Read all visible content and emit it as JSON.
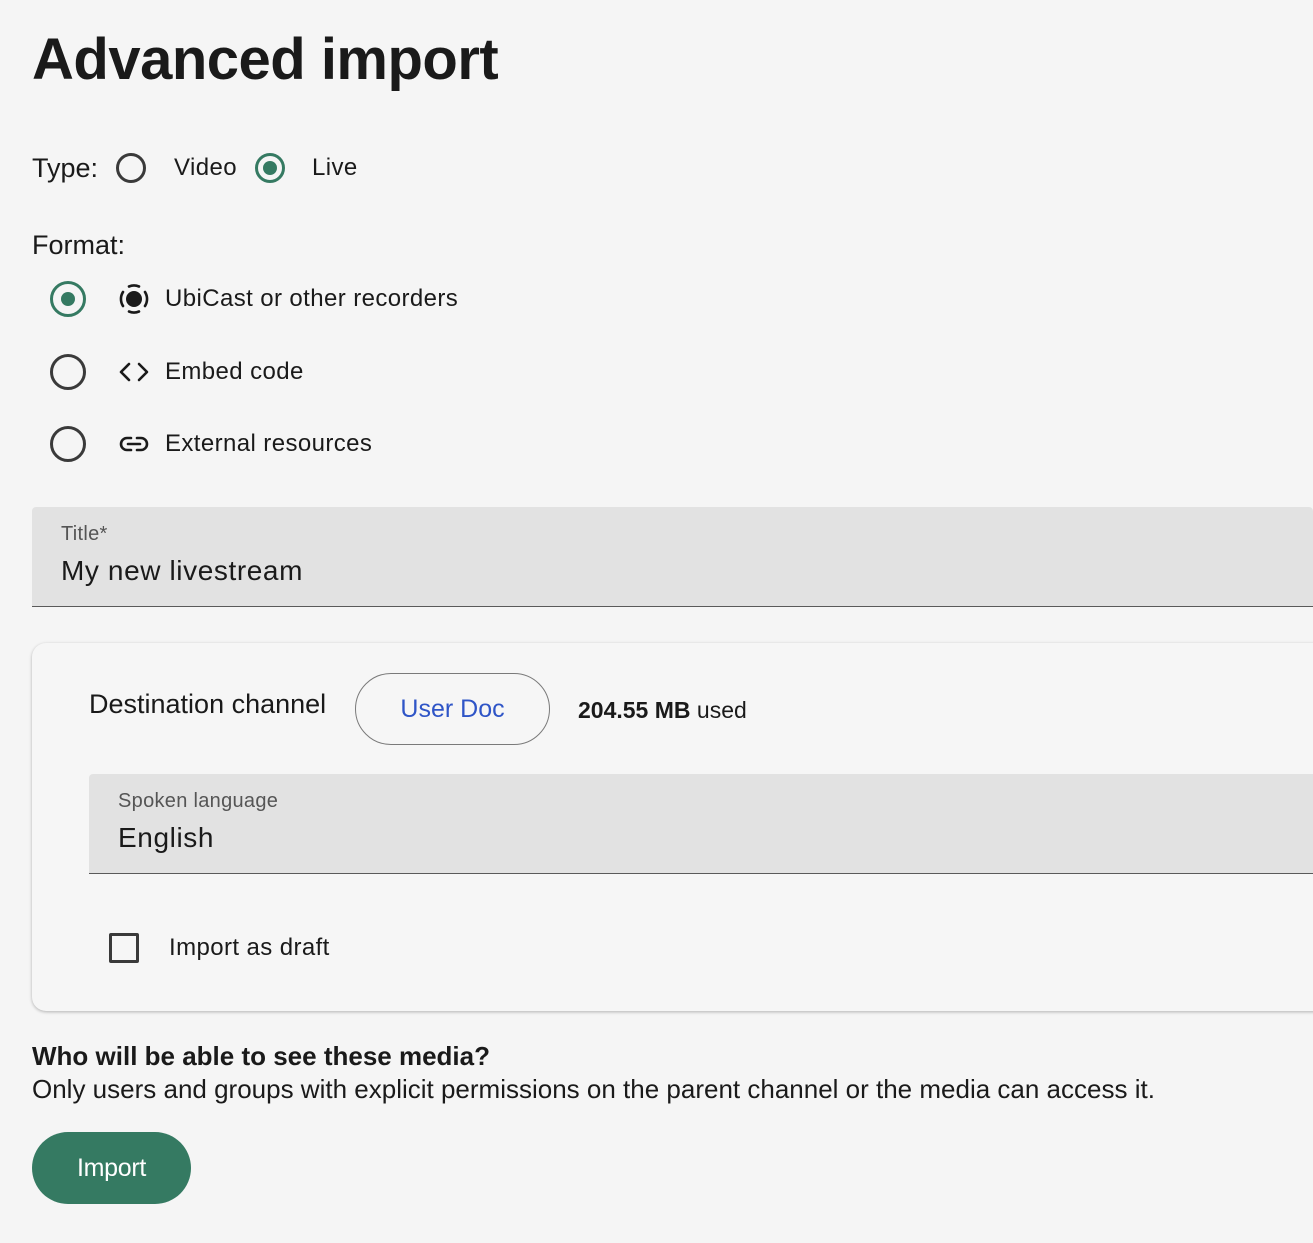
{
  "page": {
    "title": "Advanced import"
  },
  "type": {
    "label": "Type:",
    "options": [
      {
        "label": "Video",
        "checked": false
      },
      {
        "label": "Live",
        "checked": true
      }
    ]
  },
  "format": {
    "label": "Format:",
    "options": [
      {
        "label": "UbiCast or other recorders",
        "icon": "recorder-icon",
        "checked": true
      },
      {
        "label": "Embed code",
        "icon": "code-icon",
        "checked": false
      },
      {
        "label": "External resources",
        "icon": "link-icon",
        "checked": false
      }
    ]
  },
  "title_field": {
    "label": "Title*",
    "value": "My new livestream"
  },
  "destination": {
    "label": "Destination channel",
    "channel": "User Doc",
    "storage_amount": "204.55 MB",
    "storage_suffix": "used"
  },
  "language_field": {
    "label": "Spoken language",
    "value": "English"
  },
  "draft": {
    "label": "Import as draft",
    "checked": false
  },
  "visibility": {
    "title": "Who will be able to see these media?",
    "description": "Only users and groups with explicit permissions on the parent channel or the media can access it."
  },
  "actions": {
    "import_label": "Import"
  },
  "colors": {
    "accent": "#357a62",
    "link": "#2f55c7",
    "background": "#f5f5f5",
    "field": "#e2e2e2"
  }
}
